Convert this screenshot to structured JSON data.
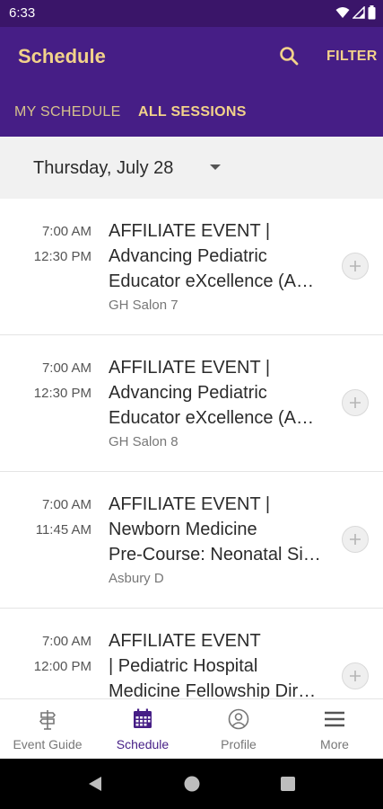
{
  "status_bar": {
    "time": "6:33",
    "icons": [
      "wifi-icon",
      "signal-icon",
      "battery-icon"
    ]
  },
  "app_bar": {
    "title": "Schedule",
    "filter_label": "FILTER",
    "icons": [
      "search-icon"
    ]
  },
  "tabs": [
    {
      "label": "MY SCHEDULE",
      "selected": false
    },
    {
      "label": "ALL SESSIONS",
      "selected": true
    }
  ],
  "date_selector": {
    "value": "Thursday, July 28"
  },
  "sessions": [
    {
      "start": "7:00 AM",
      "end": "12:30 PM",
      "title": "AFFILIATE EVENT |\nAdvancing Pediatric\nEducator eXcellence (A…",
      "room": "GH Salon 7"
    },
    {
      "start": "7:00 AM",
      "end": "12:30 PM",
      "title": "AFFILIATE EVENT |\nAdvancing Pediatric\nEducator eXcellence (A…",
      "room": "GH Salon 8"
    },
    {
      "start": "7:00 AM",
      "end": "11:45 AM",
      "title": "AFFILIATE EVENT |\nNewborn Medicine\nPre-Course: Neonatal Si…",
      "room": "Asbury D"
    },
    {
      "start": "7:00 AM",
      "end": "12:00 PM",
      "title": "AFFILIATE EVENT\n| Pediatric Hospital\nMedicine Fellowship Dir…",
      "room": ""
    }
  ],
  "bottom_nav": [
    {
      "label": "Event Guide",
      "icon": "signpost-icon",
      "active": false
    },
    {
      "label": "Schedule",
      "icon": "calendar-icon",
      "active": true
    },
    {
      "label": "Profile",
      "icon": "profile-icon",
      "active": false
    },
    {
      "label": "More",
      "icon": "menu-icon",
      "active": false
    }
  ],
  "colors": {
    "app_bar": "#461e86",
    "status_bar": "#3a1569",
    "accent_gold": "#f2d28a",
    "active_nav": "#461e86"
  }
}
